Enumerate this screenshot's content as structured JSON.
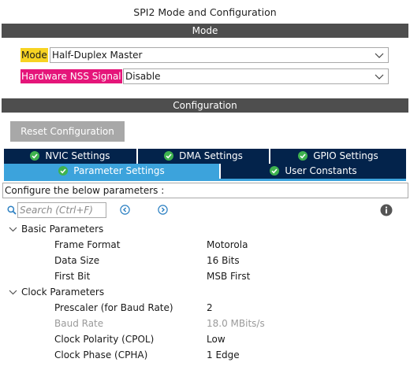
{
  "window": {
    "title": "SPI2 Mode and Configuration"
  },
  "mode_section": {
    "header": "Mode",
    "mode": {
      "label": "Mode",
      "value": "Half-Duplex Master",
      "label_color": "#f7d322"
    },
    "nss": {
      "label": "Hardware NSS Signal",
      "value": "Disable",
      "label_color": "#e5157a"
    }
  },
  "config_section": {
    "header": "Configuration",
    "reset_button": "Reset Configuration",
    "tabs": {
      "nvic": "NVIC Settings",
      "dma": "DMA Settings",
      "gpio": "GPIO Settings",
      "parameter": "Parameter Settings",
      "user_constants": "User Constants"
    },
    "active_tab": "Parameter Settings",
    "configure_text": "Configure the below parameters :",
    "search": {
      "placeholder": "Search (Ctrl+F)"
    }
  },
  "parameters": {
    "basic": {
      "label": "Basic Parameters",
      "rows": [
        {
          "name": "Frame Format",
          "value": "Motorola",
          "enabled": true
        },
        {
          "name": "Data Size",
          "value": "16 Bits",
          "enabled": true
        },
        {
          "name": "First Bit",
          "value": "MSB First",
          "enabled": true
        }
      ]
    },
    "clock": {
      "label": "Clock Parameters",
      "rows": [
        {
          "name": "Prescaler (for Baud Rate)",
          "value": "2",
          "enabled": true
        },
        {
          "name": "Baud Rate",
          "value": "18.0 MBits/s",
          "enabled": false
        },
        {
          "name": "Clock Polarity (CPOL)",
          "value": "Low",
          "enabled": true
        },
        {
          "name": "Clock Phase (CPHA)",
          "value": "1 Edge",
          "enabled": true
        }
      ]
    }
  },
  "colors": {
    "section_bar": "#4e4e4e",
    "tab_dark": "#03234b",
    "tab_active": "#3ca3dc",
    "check_green": "#3fb34f"
  }
}
